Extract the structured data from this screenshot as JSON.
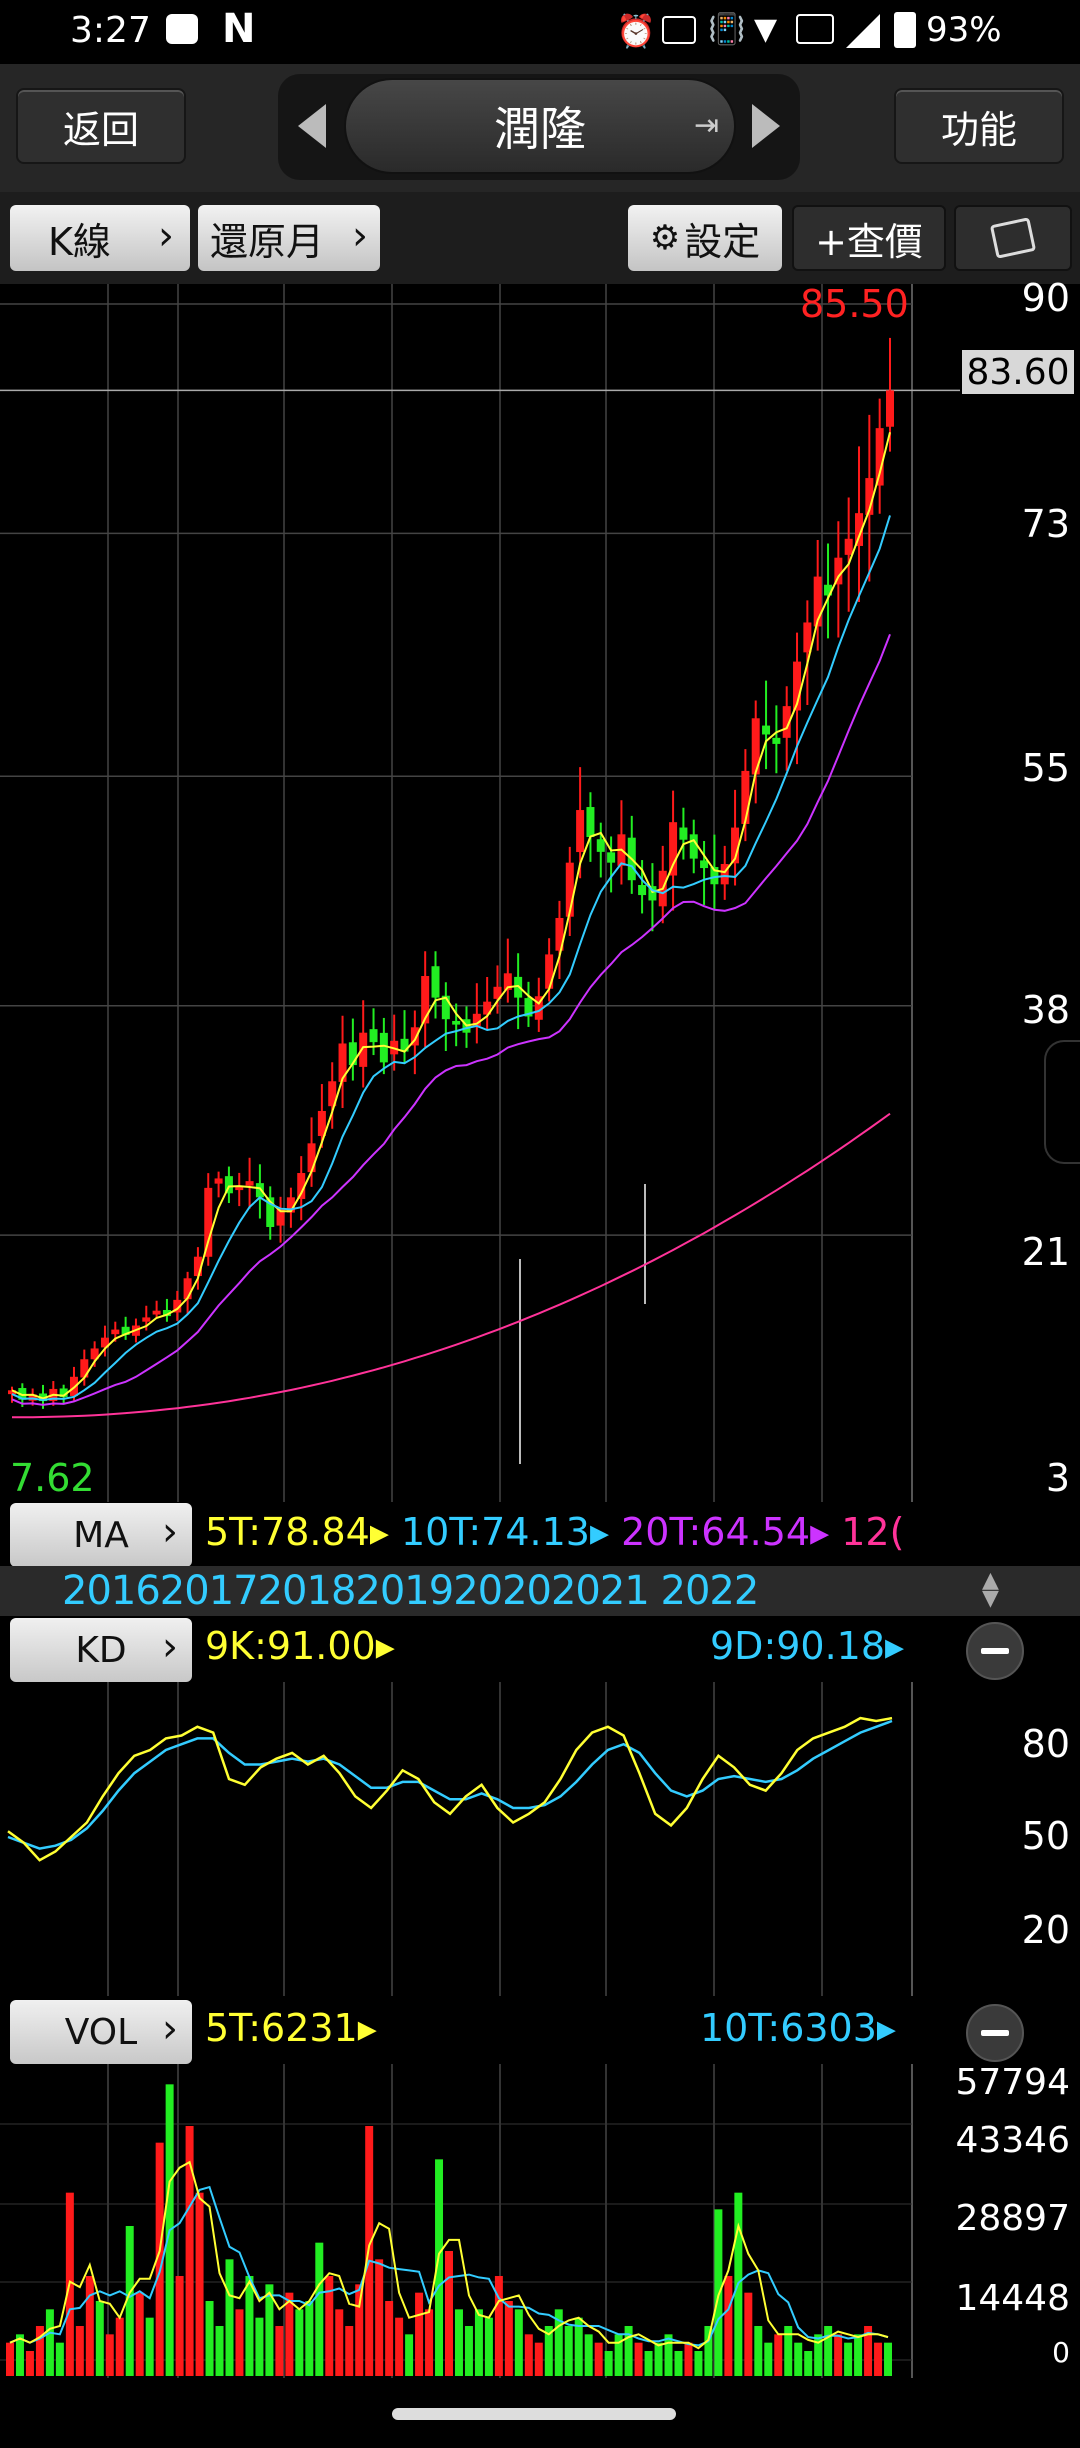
{
  "status": {
    "time": "3:27",
    "battery": "93%"
  },
  "header": {
    "back_label": "返回",
    "title": "潤隆",
    "function_label": "功能"
  },
  "toolbar": {
    "kline_label": "K線",
    "restore_label": "還原月",
    "settings_label": "設定",
    "quote_label": "+查價"
  },
  "price_axis": {
    "labels": [
      "90",
      "73",
      "55",
      "38",
      "21",
      "3"
    ],
    "current_price": "83.60"
  },
  "price_chart": {
    "high_label": "85.50",
    "low_label": "7.62"
  },
  "ma": {
    "tab_label": "MA",
    "ma5": "5T:78.84",
    "ma10": "10T:74.13",
    "ma20": "20T:64.54",
    "ma_more": "12("
  },
  "years": [
    "2016",
    "2017",
    "2018",
    "2019",
    "2020",
    "2021",
    "2022"
  ],
  "kd": {
    "tab_label": "KD",
    "k": "9K:91.00",
    "d": "9D:90.18",
    "axis": [
      "80",
      "50",
      "20"
    ]
  },
  "vol": {
    "tab_label": "VOL",
    "ma5": "5T:6231",
    "ma10": "10T:6303",
    "axis": [
      "57794",
      "43346",
      "28897",
      "14448",
      "0"
    ]
  },
  "chart_data": {
    "type": "candlestick",
    "title": "潤隆",
    "ylim": [
      3,
      90
    ],
    "current_price": 83.6,
    "series_colors": {
      "ma5": "#ffff33",
      "ma10": "#33ccff",
      "ma20": "#cc33ff",
      "ma120": "#ff3399",
      "up": "#ff1a1a",
      "down": "#22ee22"
    },
    "close_path": [
      9.5,
      8.8,
      9.2,
      8.7,
      9.6,
      9.0,
      10.5,
      11.8,
      12.6,
      13.4,
      14.0,
      13.6,
      14.3,
      14.9,
      15.4,
      15.0,
      16.2,
      17.8,
      19.4,
      24.5,
      25.2,
      24.1,
      24.6,
      25.0,
      23.8,
      21.6,
      22.9,
      23.8,
      25.6,
      27.8,
      30.2,
      32.4,
      35.2,
      33.6,
      36.0,
      35.3,
      33.8,
      35.4,
      34.6,
      36.4,
      40.2,
      38.6,
      37.0,
      36.6,
      36.0,
      37.4,
      38.3,
      39.4,
      40.4,
      38.6,
      37.2,
      38.7,
      41.8,
      44.5,
      48.6,
      52.5,
      50.5,
      49.4,
      48.6,
      50.7,
      47.3,
      46.2,
      45.8,
      48.0,
      51.6,
      50.3,
      48.9,
      48.2,
      47.0,
      48.5,
      51.2,
      55.4,
      59.3,
      58.1,
      57.4,
      60.2,
      63.5,
      66.4,
      69.8,
      68.4,
      71.2,
      72.6,
      74.5,
      77.1,
      80.8,
      83.6
    ],
    "kd_k": [
      52,
      48,
      42,
      45,
      50,
      55,
      64,
      72,
      78,
      80,
      84,
      85,
      88,
      86,
      70,
      68,
      74,
      77,
      79,
      75,
      78,
      72,
      64,
      60,
      66,
      73,
      70,
      62,
      58,
      64,
      68,
      60,
      55,
      58,
      62,
      70,
      80,
      86,
      88,
      85,
      72,
      58,
      54,
      60,
      70,
      78,
      74,
      68,
      66,
      72,
      80,
      84,
      86,
      88,
      91,
      90,
      91
    ],
    "kd_d": [
      50,
      48,
      46,
      47,
      49,
      53,
      59,
      66,
      72,
      76,
      80,
      82,
      84,
      84,
      79,
      75,
      75,
      76,
      77,
      76,
      77,
      75,
      71,
      67,
      67,
      69,
      69,
      66,
      63,
      63,
      65,
      63,
      60,
      60,
      61,
      64,
      69,
      75,
      80,
      82,
      79,
      72,
      66,
      64,
      66,
      70,
      71,
      70,
      69,
      70,
      73,
      77,
      80,
      83,
      86,
      88,
      90
    ],
    "vol_heights": [
      4,
      5,
      3,
      6,
      8,
      4,
      22,
      6,
      12,
      9,
      5,
      7,
      18,
      10,
      7,
      28,
      35,
      12,
      30,
      22,
      9,
      6,
      14,
      8,
      12,
      7,
      11,
      6,
      10,
      8,
      9,
      16,
      12,
      8,
      6,
      11,
      30,
      14,
      9,
      7,
      5,
      10,
      8,
      26,
      15,
      8,
      6,
      8,
      7,
      12,
      9,
      8,
      5,
      4,
      6,
      8,
      6,
      7,
      5,
      4,
      3,
      5,
      6,
      4,
      3,
      4,
      5,
      3,
      4,
      3,
      6,
      20,
      12,
      22,
      10,
      6,
      4,
      5,
      6,
      4,
      3,
      5,
      6,
      5,
      4,
      5,
      6,
      4,
      4
    ]
  }
}
